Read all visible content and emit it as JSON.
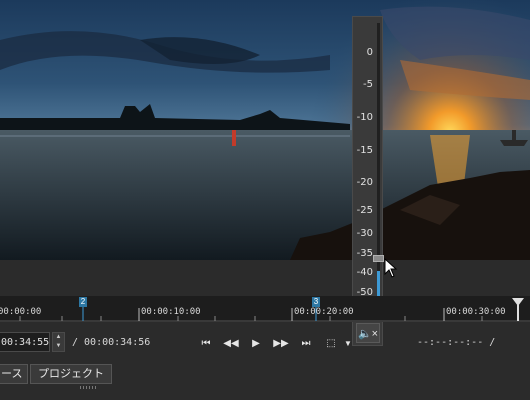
{
  "volume": {
    "scale_labels": [
      "0",
      "-5",
      "-10",
      "-15",
      "-20",
      "-25",
      "-30",
      "-35",
      "-40",
      "-50"
    ],
    "level_fraction": 0.15,
    "mute_icon": "speaker-mute-icon"
  },
  "ruler": {
    "tick_labels": [
      "00:00:00",
      "00:00:10:00",
      "00:00:20:00",
      "00:00:30:00"
    ],
    "markers": [
      "2",
      "3"
    ]
  },
  "controls": {
    "current_time": "00:34:55",
    "duration": "/ 00:00:34:56",
    "timecode_out": "--:--:--:-- /"
  },
  "tabs": {
    "tab1": "ース",
    "tab2": "プロジェクト"
  },
  "colors": {
    "accent": "#3d9ad6",
    "marker": "#2d77a3"
  }
}
